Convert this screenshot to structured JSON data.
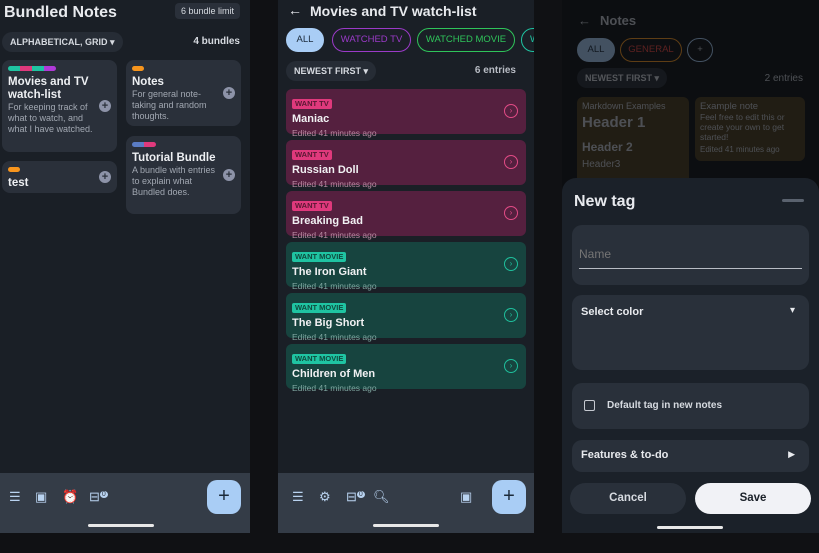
{
  "screen1": {
    "title": "Bundled Notes",
    "limit_badge": "6 bundle limit",
    "sort": "ALPHABETICAL, GRID",
    "count": "4 bundles",
    "bundles": [
      {
        "title": "Movies and TV watch-list",
        "desc": "For keeping track of what to watch, and what I have watched.",
        "tag_colors": [
          "#1fc4a2",
          "#e0397c",
          "#1fc4a2",
          "#b03ad8"
        ]
      },
      {
        "title": "Notes",
        "desc": "For general note-taking and random thoughts.",
        "tag_colors": [
          "#f7951d"
        ]
      },
      {
        "title": "test",
        "desc": "",
        "tag_colors": [
          "#f7951d"
        ]
      },
      {
        "title": "Tutorial Bundle",
        "desc": "A bundle with entries to explain what Bundled does.",
        "tag_colors": [
          "#5a7cc4",
          "#e0397c"
        ]
      }
    ],
    "bottom_icons": [
      "menu-icon",
      "gallery-icon",
      "alarm-icon",
      "inbox-badge-icon"
    ],
    "badge": "0",
    "fab": "+"
  },
  "screen2": {
    "back": "←",
    "title": "Movies and TV watch-list",
    "filters": [
      {
        "label": "ALL",
        "color": "#a9cdf5"
      },
      {
        "label": "WATCHED TV",
        "color": "#9b3ac8"
      },
      {
        "label": "WATCHED MOVIE",
        "color": "#2fc45a"
      },
      {
        "label": "W",
        "color": "#1fc4a2"
      }
    ],
    "sort": "NEWEST FIRST",
    "count": "6 entries",
    "entries": [
      {
        "tag": "WANT TV",
        "title": "Maniac",
        "edited": "Edited 41 minutes ago",
        "type": "tv"
      },
      {
        "tag": "WANT TV",
        "title": "Russian Doll",
        "edited": "Edited 41 minutes ago",
        "type": "tv"
      },
      {
        "tag": "WANT TV",
        "title": "Breaking Bad",
        "edited": "Edited 41 minutes ago",
        "type": "tv"
      },
      {
        "tag": "WANT MOVIE",
        "title": "The Iron Giant",
        "edited": "Edited 41 minutes ago",
        "type": "movie"
      },
      {
        "tag": "WANT MOVIE",
        "title": "The Big Short",
        "edited": "Edited 41 minutes ago",
        "type": "movie"
      },
      {
        "tag": "WANT MOVIE",
        "title": "Children of Men",
        "edited": "Edited 41 minutes ago",
        "type": "movie"
      }
    ],
    "badge": "0",
    "fab": "+"
  },
  "screen3": {
    "back": "←",
    "title": "Notes",
    "filters": [
      "ALL",
      "GENERAL",
      "+"
    ],
    "sort": "NEWEST FIRST",
    "count": "2 entries",
    "notes": [
      {
        "title": "Markdown Examples",
        "h1": "Header 1",
        "h2": "Header 2",
        "h3": "Header3"
      },
      {
        "title": "Example note",
        "body": "Feel free to edit this or create your own to get started!",
        "edited": "Edited 41 minutes ago"
      }
    ],
    "modal": {
      "title": "New tag",
      "name_placeholder": "Name",
      "select_color": "Select color",
      "colors": [
        "#f7951d",
        "#f2453d",
        "#f0407e",
        "#a635d0",
        "#5a7cc4",
        "#2196f3",
        "#1fc4a2"
      ],
      "default_label": "Default tag in new notes",
      "default_checked": false,
      "features": "Features & to-do",
      "cancel": "Cancel",
      "save": "Save"
    }
  }
}
